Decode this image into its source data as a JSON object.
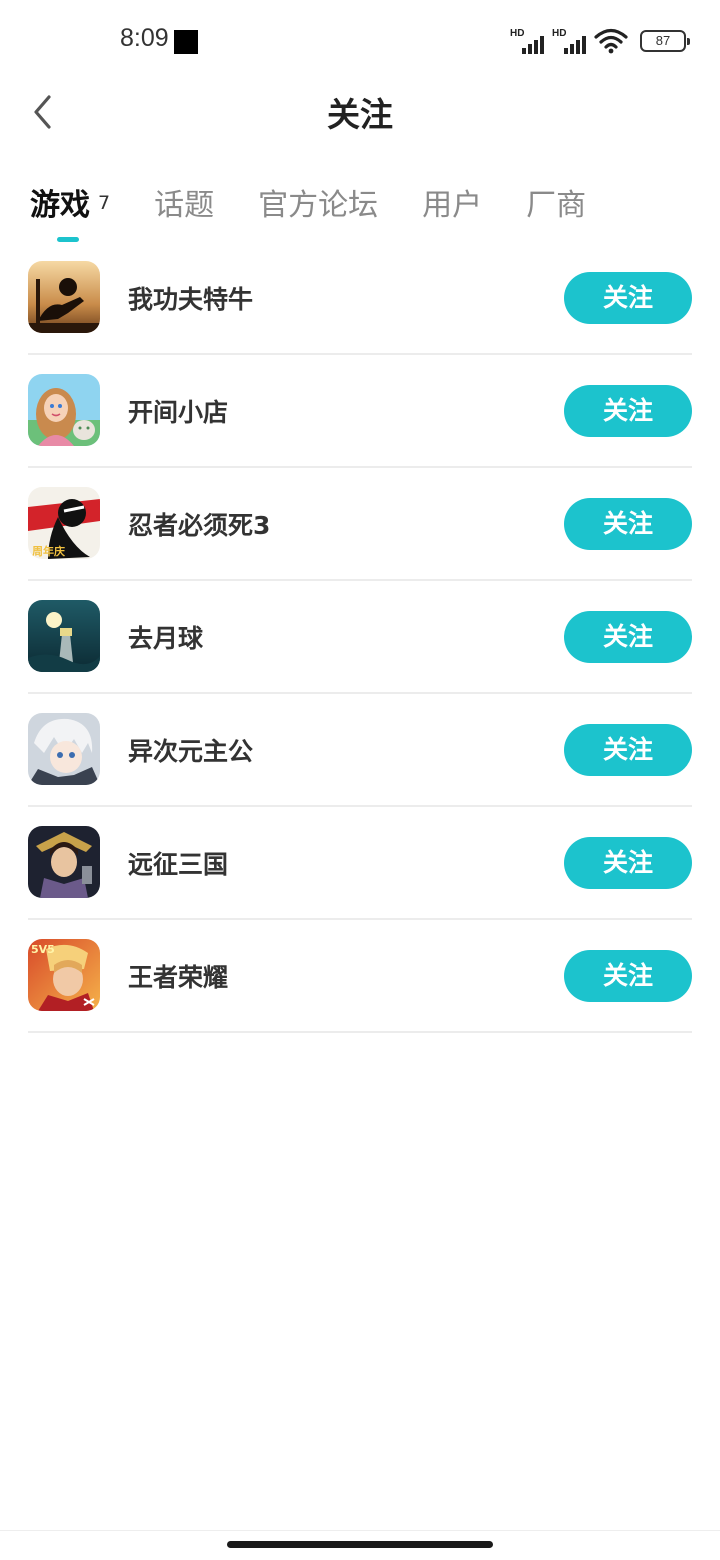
{
  "status_bar": {
    "time": "8:09",
    "signal1_label": "HD",
    "signal2_label": "HD",
    "battery": "87"
  },
  "header": {
    "title": "关注",
    "back_icon": "chevron-left-icon"
  },
  "tabs": [
    {
      "label": "游戏",
      "count": "7",
      "active": true
    },
    {
      "label": "话题",
      "active": false
    },
    {
      "label": "官方论坛",
      "active": false
    },
    {
      "label": "用户",
      "active": false
    },
    {
      "label": "厂商",
      "active": false
    }
  ],
  "games": [
    {
      "name": "我功夫特牛",
      "button": "关注"
    },
    {
      "name": "开间小店",
      "button": "关注"
    },
    {
      "name": "忍者必须死3",
      "button": "关注",
      "icon_badge": "周年庆"
    },
    {
      "name": "去月球",
      "button": "关注"
    },
    {
      "name": "异次元主公",
      "button": "关注"
    },
    {
      "name": "远征三国",
      "button": "关注"
    },
    {
      "name": "王者荣耀",
      "button": "关注",
      "icon_badge": "5V5"
    }
  ],
  "colors": {
    "accent": "#1cc3cd",
    "title": "#222222",
    "tab_inactive": "#8a8a8a",
    "divider": "#ececec"
  }
}
